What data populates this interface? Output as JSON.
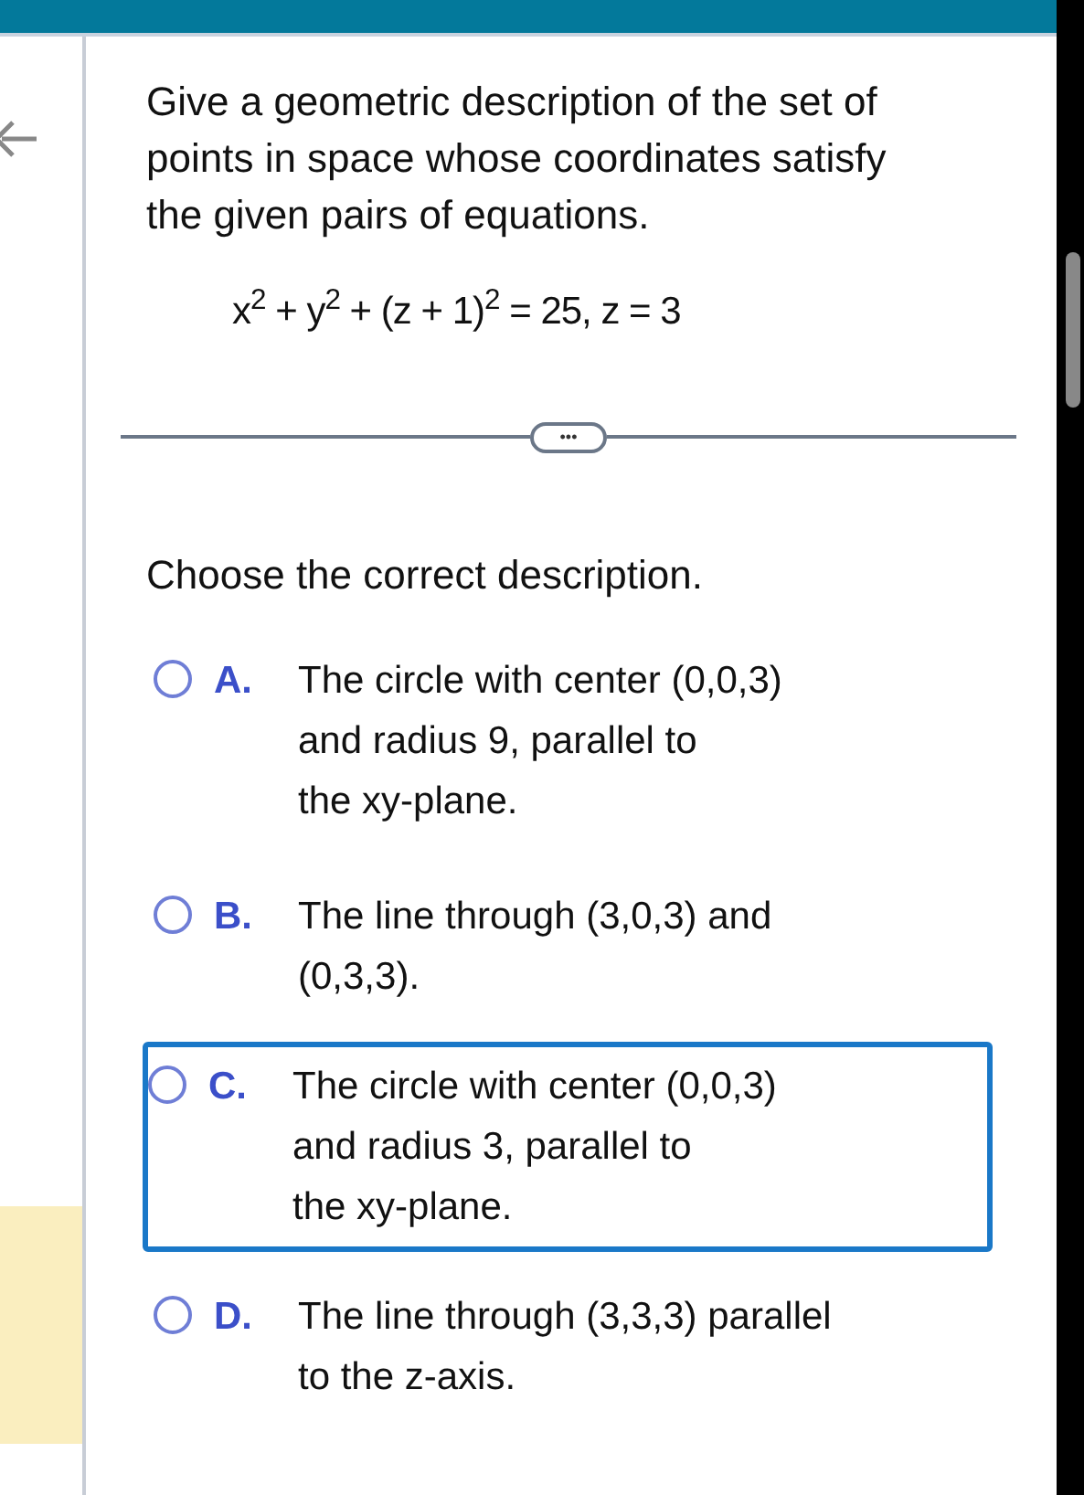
{
  "question": "Give a geometric description of the set of points in space whose coordinates satisfy the given pairs of equations.",
  "equation": "x$^{2}$ + y$^{2}$ + (z + 1)$^{2}$ = 25, z = 3",
  "expand_button": "•••",
  "prompt": "Choose the correct description.",
  "options": [
    {
      "letter": "A.",
      "text": "The circle with center (0,0,3)\nand radius 9, parallel to\nthe xy-plane.",
      "selected": false,
      "focused": false
    },
    {
      "letter": "B.",
      "text": "The line through (3,0,3) and\n(0,3,3).",
      "selected": false,
      "focused": false
    },
    {
      "letter": "C.",
      "text": "The circle with center (0,0,3)\nand radius 3, parallel to\nthe xy-plane.",
      "selected": false,
      "focused": true
    },
    {
      "letter": "D.",
      "text": "The line through (3,3,3) parallel\nto the z-axis.",
      "selected": false,
      "focused": false
    }
  ]
}
